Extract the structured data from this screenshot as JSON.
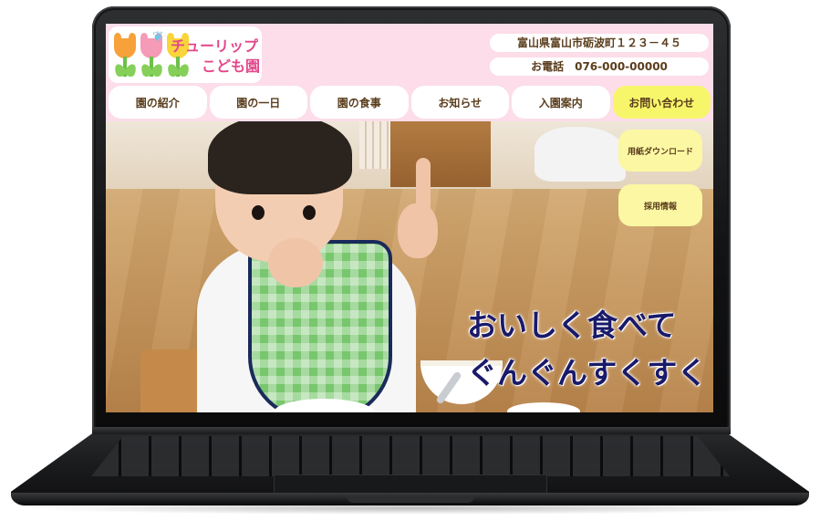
{
  "site": {
    "logo": {
      "line1": "チューリップ",
      "line2": "こども園",
      "colors": {
        "brand_pink": "#e2478a",
        "header_pink": "#fcdde9"
      },
      "icons": [
        "tulip-icon",
        "butterfly-icon"
      ]
    },
    "header": {
      "address": "富山県富山市砺波町１２３－４５",
      "phone": "お電話　076-000-00000"
    },
    "nav": {
      "items": [
        {
          "label": "園の紹介"
        },
        {
          "label": "園の一日"
        },
        {
          "label": "園の食事"
        },
        {
          "label": "お知らせ"
        },
        {
          "label": "入園案内"
        },
        {
          "label": "お問い合わせ",
          "accent": "#f7f66b"
        }
      ]
    },
    "hero": {
      "catch_line1": "おいしく食べて",
      "catch_line2": "ぐんぐんすくすく",
      "side_buttons": [
        {
          "label": "用紙ダウンロード"
        },
        {
          "label": "採用情報"
        }
      ]
    }
  }
}
